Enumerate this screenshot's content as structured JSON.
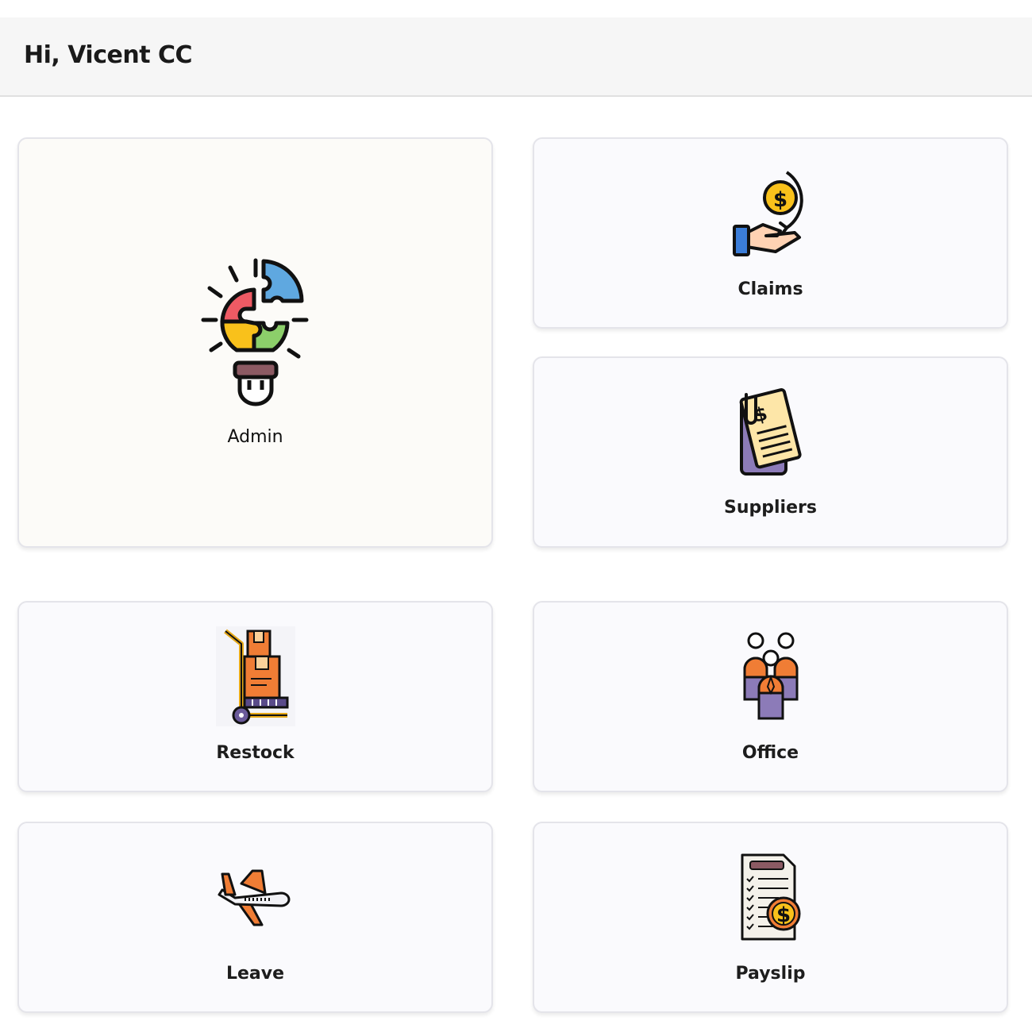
{
  "header": {
    "greeting": "Hi, Vicent CC"
  },
  "tiles": {
    "admin": {
      "label": "Admin",
      "icon": "puzzle-lightbulb-icon"
    },
    "claims": {
      "label": "Claims",
      "icon": "hand-coin-icon"
    },
    "suppliers": {
      "label": "Suppliers",
      "icon": "invoice-documents-icon"
    },
    "restock": {
      "label": "Restock",
      "icon": "hand-truck-boxes-icon"
    },
    "office": {
      "label": "Office",
      "icon": "team-people-icon"
    },
    "leave": {
      "label": "Leave",
      "icon": "airplane-icon"
    },
    "payslip": {
      "label": "Payslip",
      "icon": "payslip-document-icon"
    }
  },
  "colors": {
    "header_bg": "#f6f6f6",
    "card_bg": "#fafafd",
    "admin_card_bg": "#fcfbf8",
    "card_border": "#e4e4ea",
    "icon_orange": "#f07d35",
    "icon_yellow": "#f9c11b",
    "icon_purple": "#8c7bb8",
    "icon_blue": "#5fa8e0"
  }
}
